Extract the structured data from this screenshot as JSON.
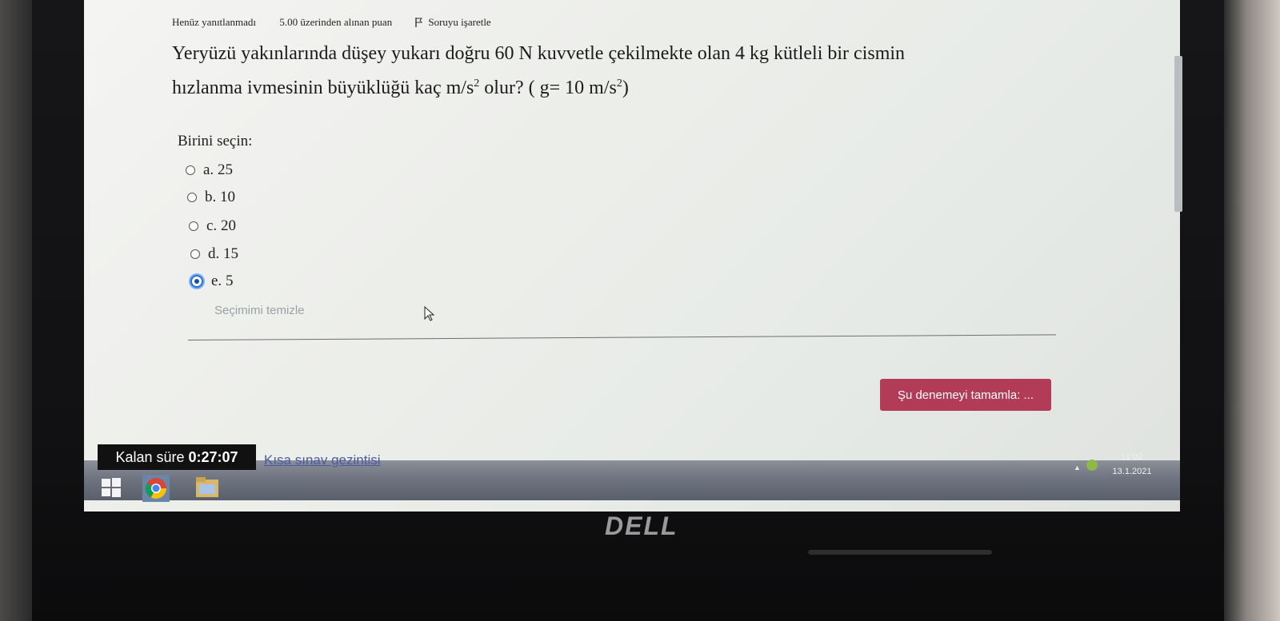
{
  "question_info": {
    "status": "Henüz yanıtlanmadı",
    "points": "5.00 üzerinden alınan puan",
    "flag_label": "Soruyu işaretle"
  },
  "question": {
    "line1": "Yeryüzü yakınlarında düşey yukarı doğru 60 N kuvvetle çekilmekte olan 4 kg kütleli bir cismin",
    "line2_prefix": "hızlanma ivmesinin büyüklüğü kaç ",
    "unit_base": "m/s",
    "exponent": "2",
    "line2_mid": " olur? ( ",
    "g_text": "g= 10 m/s",
    "line2_suffix": ")"
  },
  "choose_label": "Birini seçin:",
  "options": [
    {
      "letter": "a.",
      "value": "25",
      "selected": false
    },
    {
      "letter": "b.",
      "value": "10",
      "selected": false
    },
    {
      "letter": "c.",
      "value": "20",
      "selected": false
    },
    {
      "letter": "d.",
      "value": "15",
      "selected": false
    },
    {
      "letter": "e.",
      "value": "5",
      "selected": true
    }
  ],
  "clear_selection": "Seçimimi temizle",
  "finish_button": "Şu denemeyi tamamla: ...",
  "timer": {
    "label": "Kalan süre",
    "value": "0:27:07"
  },
  "quiz_nav": "Kısa sınav gezintisi",
  "taskbar": {
    "time": "11:02",
    "date": "13.1.2021"
  },
  "brand": "DELL",
  "colors": {
    "finish_button": "#b23b58",
    "selected_radio": "#2a72d8"
  }
}
